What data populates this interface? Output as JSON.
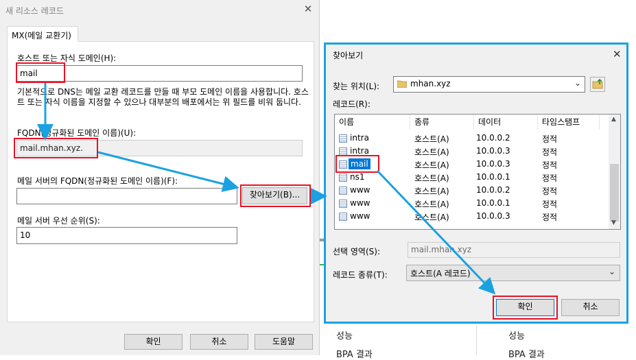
{
  "new_record_dialog": {
    "title": "새 리소스 레코드",
    "tab_label": "MX(메일 교환기)",
    "host_label": "호스트 또는 자식 도메인(H):",
    "host_value": "mail",
    "description": "기본적으로 DNS는 메일 교환 레코드를 만들 때 부모 도메인 이름을 사용합니다. 호스트 또는 자식 이름을 지정할 수 있으나 대부분의 배포에서는 위 필드를 비워 둡니다.",
    "fqdn_label": "FQDN(정규화된 도메인 이름)(U):",
    "fqdn_value": "mail.mhan.xyz.",
    "mail_server_label": "메일 서버의 FQDN(정규화된 도메인 이름)(F):",
    "mail_server_value": "",
    "browse_button": "찾아보기(B)...",
    "priority_label": "메일 서버 우선 순위(S):",
    "priority_value": "10",
    "ok_button": "확인",
    "cancel_button": "취소",
    "help_button": "도움말"
  },
  "background": {
    "perf_label_1": "성능",
    "perf_label_2": "성능",
    "bpa_label_1": "BPA 결과",
    "bpa_label_2": "BPA 결과"
  },
  "browse_dialog": {
    "title": "찾아보기",
    "look_in_label": "찾는 위치(L):",
    "look_in_value": "mhan.xyz",
    "records_label": "레코드(R):",
    "columns": [
      "이름",
      "종류",
      "데이터",
      "타임스탬프"
    ],
    "rows": [
      {
        "name": "intra",
        "type": "호스트(A)",
        "data": "10.0.0.2",
        "timestamp": "정적"
      },
      {
        "name": "intra",
        "type": "호스트(A)",
        "data": "10.0.0.3",
        "timestamp": "정적"
      },
      {
        "name": "mail",
        "type": "호스트(A)",
        "data": "10.0.0.3",
        "timestamp": "정적"
      },
      {
        "name": "ns1",
        "type": "호스트(A)",
        "data": "10.0.0.1",
        "timestamp": "정적"
      },
      {
        "name": "www",
        "type": "호스트(A)",
        "data": "10.0.0.2",
        "timestamp": "정적"
      },
      {
        "name": "www",
        "type": "호스트(A)",
        "data": "10.0.0.1",
        "timestamp": "정적"
      },
      {
        "name": "www",
        "type": "호스트(A)",
        "data": "10.0.0.3",
        "timestamp": "정적"
      }
    ],
    "selected_row": 2,
    "selection_label": "선택 영역(S):",
    "selection_value": "mail.mhan.xyz",
    "record_type_label": "레코드 종류(T):",
    "record_type_value": "호스트(A 레코드)",
    "ok_button": "확인",
    "cancel_button": "취소"
  },
  "colors": {
    "highlight": "#e81123",
    "arrow": "#1ba1e2",
    "selection": "#0078d7"
  }
}
